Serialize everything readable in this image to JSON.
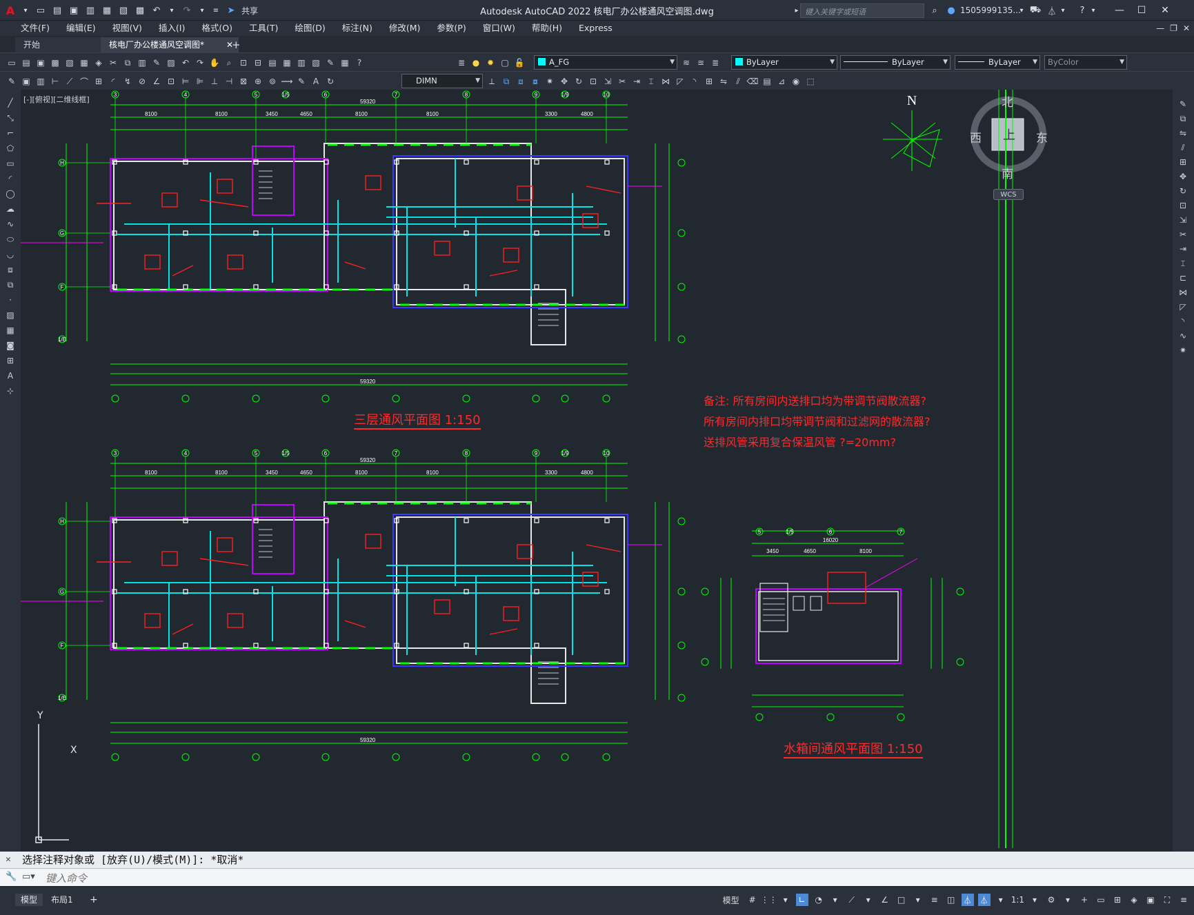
{
  "app": {
    "title": "Autodesk AutoCAD 2022    核电厂办公楼通风空调图.dwg",
    "share_label": "共享",
    "search_placeholder": "键入关键字或短语",
    "user": "1505999135...",
    "accent_color": "#e81123"
  },
  "menu": {
    "items": [
      "文件(F)",
      "编辑(E)",
      "视图(V)",
      "插入(I)",
      "格式(O)",
      "工具(T)",
      "绘图(D)",
      "标注(N)",
      "修改(M)",
      "参数(P)",
      "窗口(W)",
      "帮助(H)",
      "Express"
    ]
  },
  "tabs": {
    "start": "开始",
    "active": "核电厂办公楼通风空调图*",
    "add": "+"
  },
  "toolbar": {
    "layer": "A_FG",
    "color": "ByLayer",
    "linetype": "ByLayer",
    "lineweight": "ByLayer",
    "plotstyle": "ByColor",
    "dimstyle": "DIMN",
    "layer_swatch_color": "#00ffff"
  },
  "viewport": {
    "label": "[-][俯视][二维线框]",
    "viewcube": {
      "north": "北",
      "south": "南",
      "east": "东",
      "west": "西",
      "top": "上",
      "ucs": "WCS"
    },
    "north_arrow": "N",
    "axis_y": "Y",
    "axis_x": "X"
  },
  "drawing": {
    "notes": [
      "备注: 所有房间内送排口均为带调节阀散流器?",
      "所有房间内排口均带调节阀和过滤网的散流器?",
      "送排风管采用复合保温风管 ?=20mm?"
    ],
    "plan_titles": {
      "floor3": "三层通风平面图 1:150",
      "tank": "水箱间通风平面图 1:150"
    },
    "axis_labels_top": [
      "3",
      "4",
      "5",
      "1/5",
      "6",
      "7",
      "8",
      "9",
      "1/9",
      "10"
    ],
    "dims_top": [
      "8100",
      "8100",
      "3450",
      "4650",
      "8100",
      "8100",
      "3300",
      "4800"
    ],
    "total_dim": "59320",
    "axis_labels_side": [
      "H",
      "G",
      "F",
      "1/E"
    ],
    "tank_axis_labels": [
      "5",
      "1/5",
      "6",
      "7"
    ],
    "tank_dims": [
      "3450",
      "4650",
      "8100"
    ],
    "tank_total": "16020"
  },
  "command": {
    "history": "选择注释对象或 [放弃(U)/模式(M)]: *取消*",
    "placeholder": "键入命令"
  },
  "status": {
    "model_tab": "模型",
    "layout_tab": "布局1",
    "model_space": "模型",
    "scale": "1:1"
  }
}
